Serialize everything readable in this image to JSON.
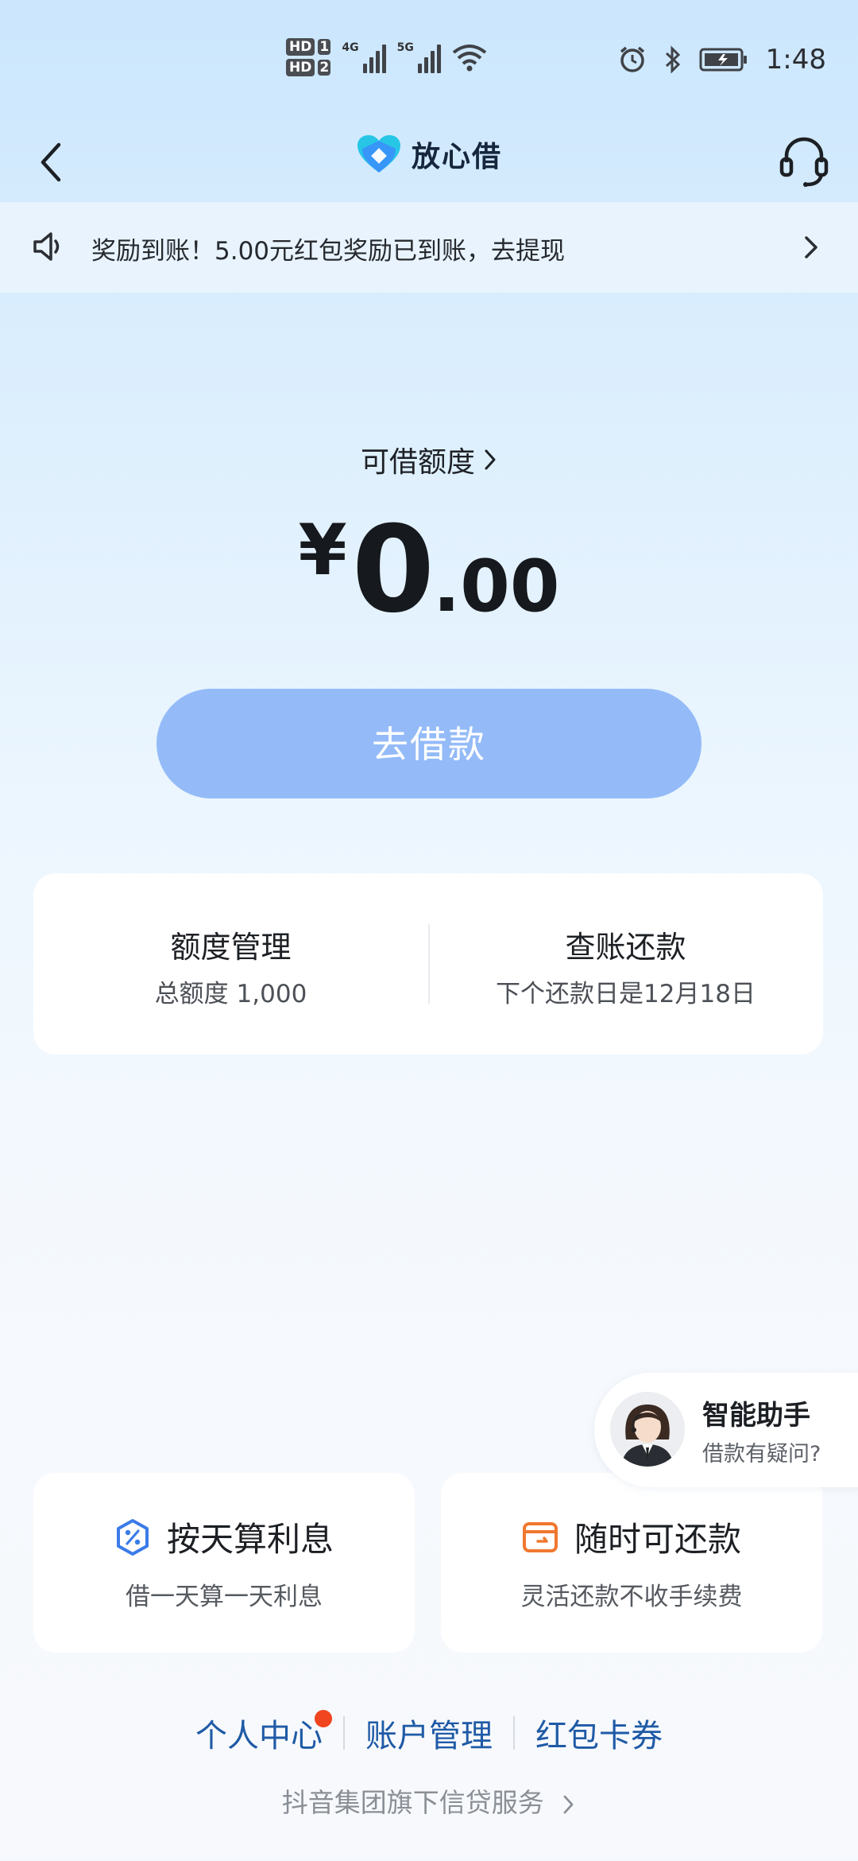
{
  "status_bar": {
    "sim1": "HD",
    "sim1_num": "1",
    "sim2": "HD",
    "sim2_num": "2",
    "net1": "4G",
    "net2": "5G",
    "time": "1:48"
  },
  "nav": {
    "title": "放心借"
  },
  "notice": {
    "text": "奖励到账！5.00元红包奖励已到账，去提现"
  },
  "credit": {
    "label": "可借额度",
    "currency": "¥",
    "amount_int": "0",
    "amount_dec": ".00",
    "button": "去借款"
  },
  "quota_card": {
    "left_title": "额度管理",
    "left_sub": "总额度 1,000",
    "right_title": "查账还款",
    "right_sub": "下个还款日是12月18日"
  },
  "assistant": {
    "title": "智能助手",
    "sub": "借款有疑问?"
  },
  "features": [
    {
      "title": "按天算利息",
      "sub": "借一天算一天利息",
      "icon": "percent-shield-icon",
      "color": "#3b7be8"
    },
    {
      "title": "随时可还款",
      "sub": "灵活还款不收手续费",
      "icon": "wallet-icon",
      "color": "#f0782f"
    }
  ],
  "footer": {
    "links": [
      "个人中心",
      "账户管理",
      "红包卡券"
    ],
    "group_text": "抖音集团旗下信贷服务"
  },
  "colors": {
    "accent": "#94bbf8",
    "link": "#1f5aa6",
    "badge": "#f0451f"
  }
}
